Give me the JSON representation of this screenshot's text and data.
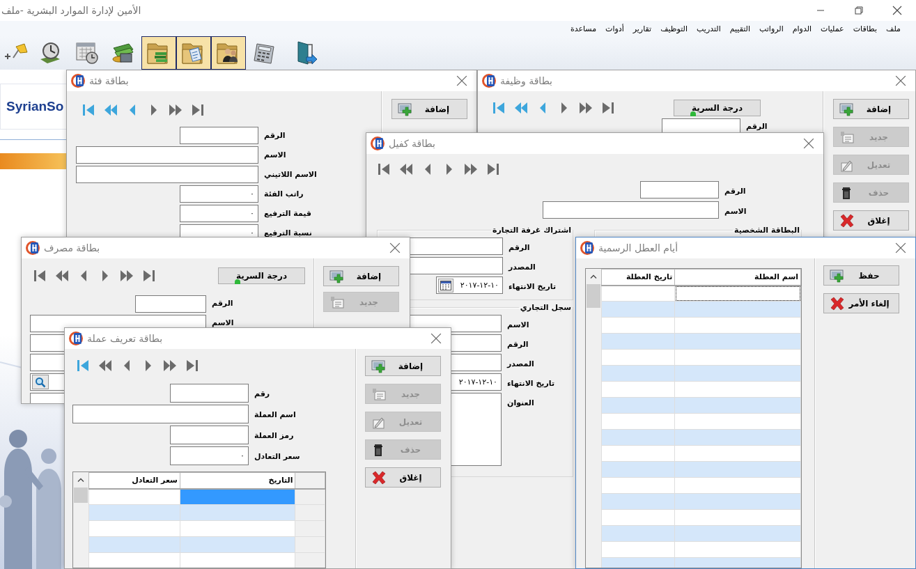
{
  "app": {
    "title": "الأمين لإدارة الموارد البشرية -ملف"
  },
  "menu": [
    "ملف",
    "بطاقات",
    "عمليات",
    "الدوام",
    "الرواتب",
    "التقييم",
    "التدريب",
    "التوظيف",
    "تقارير",
    "أدوات",
    "مساعدة"
  ],
  "toolbar": [
    {
      "kind": "pin",
      "highlighted": false
    },
    {
      "kind": "clock",
      "highlighted": false
    },
    {
      "kind": "calendar-clock",
      "highlighted": false
    },
    {
      "kind": "money",
      "highlighted": false
    },
    {
      "kind": "folder-books",
      "highlighted": true
    },
    {
      "kind": "folder-document",
      "highlighted": true
    },
    {
      "kind": "folder-people",
      "highlighted": true
    },
    {
      "kind": "calculator",
      "highlighted": false
    },
    {
      "kind": "door",
      "highlighted": false
    }
  ],
  "logo": {
    "text": "SyrianSo"
  },
  "category_card": {
    "title": "بطاقة فئة",
    "nav": [
      {
        "kind": "first",
        "highlighted": true
      },
      {
        "kind": "prev-page",
        "highlighted": true
      },
      {
        "kind": "prev",
        "highlighted": true
      },
      {
        "kind": "next",
        "highlighted": false
      },
      {
        "kind": "next-page",
        "highlighted": false
      },
      {
        "kind": "last",
        "highlighted": false
      }
    ],
    "fields": [
      {
        "kind": "text",
        "label": "الرقم"
      },
      {
        "kind": "text",
        "label": "الاسم"
      },
      {
        "kind": "text",
        "label": "الاسم اللاتيني"
      },
      {
        "kind": "text",
        "label": "راتب الفئة",
        "value": "٠"
      },
      {
        "kind": "text",
        "label": "قيمة الترفيع",
        "value": "٠"
      },
      {
        "kind": "text",
        "label": "نسبة الترفيع",
        "value": "٠"
      }
    ],
    "buttons": [
      {
        "kind": "add",
        "label": "إضافة",
        "disabled": false
      }
    ]
  },
  "job_card": {
    "title": "بطاقة وظيفة",
    "nav": [
      {
        "kind": "first",
        "highlighted": true
      },
      {
        "kind": "prev-page",
        "highlighted": true
      },
      {
        "kind": "prev",
        "highlighted": true
      },
      {
        "kind": "next",
        "highlighted": false
      },
      {
        "kind": "next-page",
        "highlighted": false
      },
      {
        "kind": "last",
        "highlighted": false
      }
    ],
    "secrecy_button": "درجة السرية",
    "fields": [
      {
        "kind": "text",
        "label": "الرقم"
      }
    ],
    "buttons": [
      {
        "kind": "add",
        "label": "إضافة",
        "disabled": false
      },
      {
        "kind": "new",
        "label": "جديد",
        "disabled": true
      },
      {
        "kind": "edit",
        "label": "تعديل",
        "disabled": true
      },
      {
        "kind": "delete",
        "label": "حذف",
        "disabled": true
      },
      {
        "kind": "close",
        "label": "إغلاق",
        "disabled": false
      }
    ]
  },
  "sponsor_card": {
    "title": "بطاقة كفيل",
    "nav": [
      {
        "kind": "first",
        "highlighted": false
      },
      {
        "kind": "prev-page",
        "highlighted": false
      },
      {
        "kind": "prev",
        "highlighted": false
      },
      {
        "kind": "next",
        "highlighted": false
      },
      {
        "kind": "next-page",
        "highlighted": false
      },
      {
        "kind": "last",
        "highlighted": false
      }
    ],
    "fields": [
      {
        "kind": "text",
        "label": "الرقم"
      },
      {
        "kind": "text",
        "label": "الاسم"
      }
    ],
    "groups": [
      {
        "title": "البطاقة الشخصية"
      },
      {
        "title": "اشتراك غرفة التجارة",
        "fields": [
          {
            "kind": "text",
            "label": "الرقم"
          },
          {
            "kind": "text",
            "label": "المصدر"
          },
          {
            "kind": "date",
            "label": "تاريخ الانتهاء",
            "value": "١٠-١٢-٢٠١٧"
          }
        ]
      },
      {
        "title": "سجل التجاري",
        "fields": [
          {
            "kind": "text",
            "label": "الاسم"
          },
          {
            "kind": "text",
            "label": "الرقم"
          },
          {
            "kind": "text",
            "label": "المصدر"
          },
          {
            "kind": "text",
            "label": "تاريخ الانتهاء",
            "value": "١٠-١٢-٢٠١٧"
          },
          {
            "kind": "memo",
            "label": "العنوان"
          }
        ]
      }
    ]
  },
  "bank_card": {
    "title": "بطاقة مصرف",
    "nav": [
      {
        "kind": "first",
        "highlighted": false
      },
      {
        "kind": "prev-page",
        "highlighted": false
      },
      {
        "kind": "prev",
        "highlighted": false
      },
      {
        "kind": "next",
        "highlighted": false
      },
      {
        "kind": "next-page",
        "highlighted": false
      },
      {
        "kind": "last",
        "highlighted": false
      }
    ],
    "secrecy_button": "درجة السرية",
    "fields": [
      {
        "kind": "text",
        "label": "الرقم"
      },
      {
        "kind": "text",
        "label": "الاسم"
      },
      {
        "kind": "text"
      },
      {
        "kind": "text"
      },
      {
        "kind": "search"
      },
      {
        "kind": "text"
      }
    ],
    "buttons": [
      {
        "kind": "add",
        "label": "إضافة",
        "disabled": false
      },
      {
        "kind": "new",
        "label": "جديد",
        "disabled": true
      }
    ]
  },
  "currency_card": {
    "title": "بطاقة تعريف عملة",
    "nav": [
      {
        "kind": "first",
        "highlighted": true
      },
      {
        "kind": "prev-page",
        "highlighted": false
      },
      {
        "kind": "prev",
        "highlighted": false
      },
      {
        "kind": "next",
        "highlighted": false
      },
      {
        "kind": "next-page",
        "highlighted": false
      },
      {
        "kind": "last",
        "highlighted": false
      }
    ],
    "fields": [
      {
        "kind": "text",
        "label": "رقم"
      },
      {
        "kind": "text",
        "label": "اسم العملة"
      },
      {
        "kind": "text",
        "label": "رمز العملة"
      },
      {
        "kind": "text",
        "label": "سعر التعادل",
        "value": "٠"
      }
    ],
    "grid": {
      "columns": [
        "التاريخ",
        "سعر التعادل"
      ],
      "rows": [
        {
          "selected": true
        },
        {
          "selected": false
        },
        {
          "selected": false
        },
        {
          "selected": false
        },
        {
          "selected": false
        }
      ]
    },
    "buttons": [
      {
        "kind": "add",
        "label": "إضافة",
        "disabled": false
      },
      {
        "kind": "new",
        "label": "جديد",
        "disabled": true
      },
      {
        "kind": "edit",
        "label": "تعديل",
        "disabled": true
      },
      {
        "kind": "delete",
        "label": "حذف",
        "disabled": true
      },
      {
        "kind": "close",
        "label": "إغلاق",
        "disabled": false
      }
    ]
  },
  "holidays": {
    "title": "أيام العطل الرسمية",
    "grid": {
      "columns": [
        "اسم العطلة",
        "تاريخ العطلة"
      ],
      "rows": [
        {
          "focused": true
        },
        {
          "focused": false
        },
        {
          "focused": false
        },
        {
          "focused": false
        },
        {
          "focused": false
        },
        {
          "focused": false
        },
        {
          "focused": false
        },
        {
          "focused": false
        },
        {
          "focused": false
        },
        {
          "focused": false
        },
        {
          "focused": false
        },
        {
          "focused": false
        },
        {
          "focused": false
        },
        {
          "focused": false
        },
        {
          "focused": false
        },
        {
          "focused": false
        },
        {
          "focused": false
        },
        {
          "focused": false
        }
      ]
    },
    "buttons": [
      {
        "kind": "save",
        "label": "حفظ",
        "disabled": false
      },
      {
        "kind": "close",
        "label": "إلغاء الأمر",
        "disabled": false
      }
    ]
  }
}
